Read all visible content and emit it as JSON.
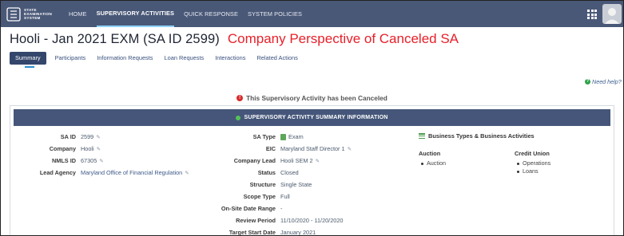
{
  "app": {
    "logo_lines": [
      "STATE",
      "EXAMINATION",
      "SYSTEM"
    ]
  },
  "nav": {
    "items": [
      {
        "label": "HOME",
        "active": false
      },
      {
        "label": "SUPERVISORY ACTIVITIES",
        "active": true
      },
      {
        "label": "QUICK RESPONSE",
        "active": false
      },
      {
        "label": "SYSTEM POLICIES",
        "active": false
      }
    ]
  },
  "page": {
    "title": "Hooli - Jan 2021 EXM (SA ID 2599)",
    "annotation": "Company Perspective of Canceled SA"
  },
  "tabs": [
    {
      "label": "Summary",
      "active": true
    },
    {
      "label": "Participants",
      "active": false
    },
    {
      "label": "Information Requests",
      "active": false
    },
    {
      "label": "Loan Requests",
      "active": false
    },
    {
      "label": "Interactions",
      "active": false
    },
    {
      "label": "Related Actions",
      "active": false
    }
  ],
  "help": {
    "label": "Need help?"
  },
  "banner": {
    "text": "This Supervisory Activity has been Canceled"
  },
  "panel": {
    "header": "SUPERVISORY ACTIVITY SUMMARY INFORMATION",
    "left_fields": [
      {
        "label": "SA ID",
        "value": "2599"
      },
      {
        "label": "Company",
        "value": "Hooli"
      },
      {
        "label": "NMLS ID",
        "value": "67305"
      },
      {
        "label": "Lead Agency",
        "value": "Maryland Office of Financial Regulation"
      }
    ],
    "mid_fields": [
      {
        "label": "SA Type",
        "value": "Exam"
      },
      {
        "label": "EIC",
        "value": "Maryland Staff Director 1"
      },
      {
        "label": "Company Lead",
        "value": "Hooli SEM 2"
      },
      {
        "label": "Status",
        "value": "Closed"
      },
      {
        "label": "Structure",
        "value": "Single State"
      },
      {
        "label": "Scope Type",
        "value": "Full"
      },
      {
        "label": "On-Site Date Range",
        "value": "-"
      },
      {
        "label": "Review Period",
        "value": "11/10/2020 - 11/20/2020"
      },
      {
        "label": "Target Start Date",
        "value": "January 2021"
      }
    ],
    "business": {
      "title": "Business Types & Business Activities",
      "groups": [
        {
          "name": "Auction",
          "items": [
            "Auction"
          ]
        },
        {
          "name": "Credit Union",
          "items": [
            "Operations",
            "Loans"
          ]
        }
      ]
    }
  },
  "colors": {
    "nav_bg": "#4a5878",
    "panel_header_bg": "#45567a",
    "annotation_red": "#e8202a",
    "warning_red": "#d62c2c",
    "status_green": "#55c257"
  },
  "icons": [
    "logo-icon",
    "apps-grid-icon",
    "avatar",
    "help-icon",
    "warning-icon",
    "status-dot-icon",
    "edit-icon",
    "exam-icon",
    "list-icon"
  ]
}
